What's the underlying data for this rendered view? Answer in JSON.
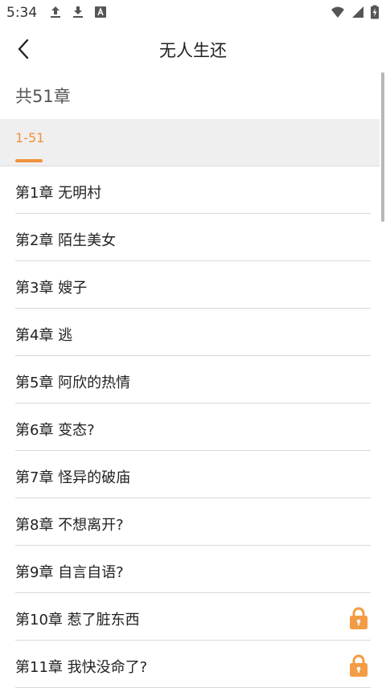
{
  "status_bar": {
    "time": "5:34",
    "icons_left": [
      "upload-icon",
      "download-icon",
      "font-a-icon"
    ],
    "icons_right": [
      "wifi-icon",
      "signal-icon",
      "battery-charging-icon"
    ]
  },
  "app_bar": {
    "title": "无人生还",
    "back_icon": "chevron-left-icon"
  },
  "chapter_count": "共51章",
  "range_tabs": [
    {
      "label": "1-51",
      "selected": true
    }
  ],
  "chapters": [
    {
      "title": "第1章 无明村",
      "locked": false
    },
    {
      "title": "第2章 陌生美女",
      "locked": false
    },
    {
      "title": "第3章 嫂子",
      "locked": false
    },
    {
      "title": "第4章 逃",
      "locked": false
    },
    {
      "title": "第5章 阿欣的热情",
      "locked": false
    },
    {
      "title": "第6章 变态?",
      "locked": false
    },
    {
      "title": "第7章 怪异的破庙",
      "locked": false
    },
    {
      "title": "第8章 不想离开?",
      "locked": false
    },
    {
      "title": "第9章 自言自语?",
      "locked": false
    },
    {
      "title": "第10章 惹了脏东西",
      "locked": true
    },
    {
      "title": "第11章 我快没命了?",
      "locked": true
    }
  ],
  "colors": {
    "accent": "#f0923a",
    "range_bar_bg": "#efefef",
    "divider": "#d9d9d9",
    "lock": "#f39c45"
  }
}
